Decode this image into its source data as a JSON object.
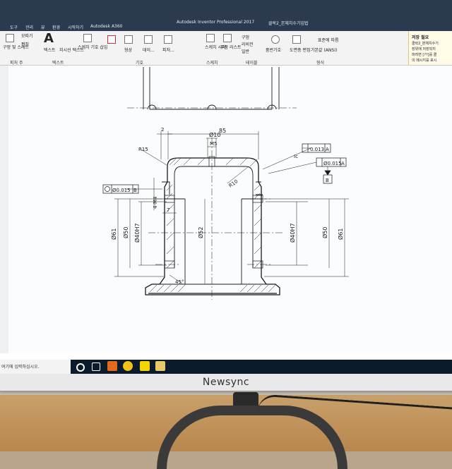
{
  "app": {
    "title": "Autodesk Inventor Professional 2017",
    "document": "클락2_본체치수기입법"
  },
  "menu_tabs": [
    "도구",
    "관리",
    "뷰",
    "환경",
    "시작하기",
    "Autodesk A360"
  ],
  "ribbon": {
    "buttons": [
      {
        "label": "구멍 및 스레드"
      },
      {
        "label": "모따기"
      },
      {
        "label": "편집"
      },
      {
        "label": "텍스트"
      },
      {
        "label": "지시선 텍스트"
      },
      {
        "label": "스케치 기호 삽입"
      },
      {
        "label": "형상"
      },
      {
        "label": "데이..."
      },
      {
        "label": "피처..."
      },
      {
        "label": "스케치 시작"
      },
      {
        "label": "부품 리스트"
      },
      {
        "label": "구멍"
      },
      {
        "label": "리비전"
      },
      {
        "label": "일반"
      },
      {
        "label": "품번기호"
      },
      {
        "label": "도면층 편집"
      },
      {
        "label": "표준에 따름"
      },
      {
        "label": "기본값 (ANSI)"
      }
    ],
    "groups": [
      "피처 주",
      "텍스트",
      "기호",
      "스케치",
      "테이블",
      "형식"
    ]
  },
  "notice": {
    "title": "저장 필요",
    "lines": [
      "클락2_본체치수기",
      "장위에 저장되지",
      "파려면 [??]를 클",
      "의 메시지를 표시"
    ]
  },
  "taskbar": {
    "search_placeholder": "여기에 입력하십시오."
  },
  "drawing": {
    "labels": {
      "d10": "Ø10",
      "w85": "85",
      "m5": "M5",
      "d2": "2",
      "r15": "R15",
      "r10": "R10",
      "tol1": "0.013",
      "tol1_datum": "A",
      "tol2": "Ø0.015",
      "tol2_datum": "A",
      "datum_b": "B",
      "lc": "Ic",
      "conc": "Ø0.015",
      "conc_datum": "B",
      "thread": "4-M4",
      "seven": "7",
      "angle": "45°",
      "l_d61": "Ø61",
      "l_d50": "Ø50",
      "l_d40": "Ø40H7",
      "c_d52": "Ø52",
      "r_d40": "Ø40H7",
      "r_d50": "Ø50",
      "r_d61": "Ø61"
    }
  },
  "monitor": {
    "brand": "Newsync"
  },
  "colors": {
    "titlebar": "#2b3a4f",
    "ribbon": "#f3f3f3",
    "taskbar": "#0c1b2c",
    "drawing_line": "#1a1a1a"
  }
}
